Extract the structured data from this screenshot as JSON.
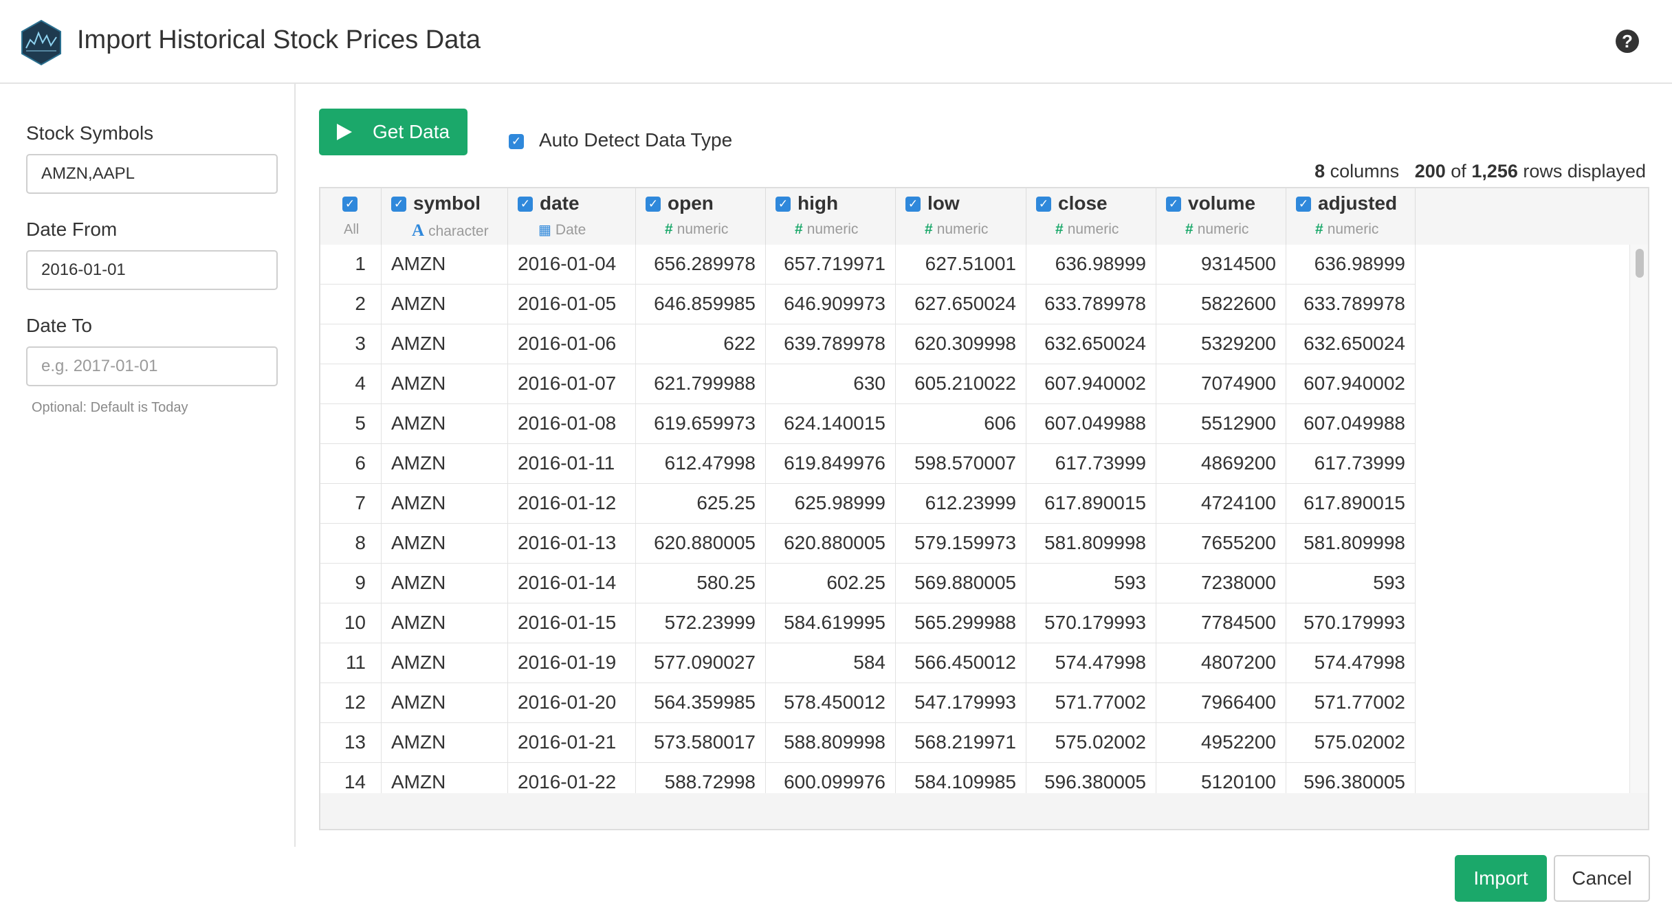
{
  "window": {
    "title": "Import Historical Stock Prices Data",
    "logo_icon": "tidyquant-hex-logo",
    "help_icon": "question-circle-icon"
  },
  "sidebar": {
    "symbols_label": "Stock Symbols",
    "symbols_value": "AMZN,AAPL",
    "date_from_label": "Date From",
    "date_from_value": "2016-01-01",
    "date_to_label": "Date To",
    "date_to_value": "",
    "date_to_placeholder": "e.g. 2017-01-01",
    "date_to_hint": "Optional: Default is Today"
  },
  "toolbar": {
    "get_data_label": "Get Data",
    "auto_detect_label": "Auto Detect Data Type",
    "auto_detect_checked": true
  },
  "summary": {
    "columns_count": "8",
    "columns_word": "columns",
    "rows_shown": "200",
    "of_word": "of",
    "rows_total": "1,256",
    "rows_word": "rows displayed"
  },
  "table": {
    "all_label": "All",
    "columns": [
      {
        "name": "symbol",
        "type": "character",
        "type_icon": "A"
      },
      {
        "name": "date",
        "type": "Date",
        "type_icon": "calendar-icon"
      },
      {
        "name": "open",
        "type": "numeric",
        "type_icon": "#"
      },
      {
        "name": "high",
        "type": "numeric",
        "type_icon": "#"
      },
      {
        "name": "low",
        "type": "numeric",
        "type_icon": "#"
      },
      {
        "name": "close",
        "type": "numeric",
        "type_icon": "#"
      },
      {
        "name": "volume",
        "type": "numeric",
        "type_icon": "#"
      },
      {
        "name": "adjusted",
        "type": "numeric",
        "type_icon": "#"
      }
    ],
    "rows": [
      [
        "1",
        "AMZN",
        "2016-01-04",
        "656.289978",
        "657.719971",
        "627.51001",
        "636.98999",
        "9314500",
        "636.98999"
      ],
      [
        "2",
        "AMZN",
        "2016-01-05",
        "646.859985",
        "646.909973",
        "627.650024",
        "633.789978",
        "5822600",
        "633.789978"
      ],
      [
        "3",
        "AMZN",
        "2016-01-06",
        "622",
        "639.789978",
        "620.309998",
        "632.650024",
        "5329200",
        "632.650024"
      ],
      [
        "4",
        "AMZN",
        "2016-01-07",
        "621.799988",
        "630",
        "605.210022",
        "607.940002",
        "7074900",
        "607.940002"
      ],
      [
        "5",
        "AMZN",
        "2016-01-08",
        "619.659973",
        "624.140015",
        "606",
        "607.049988",
        "5512900",
        "607.049988"
      ],
      [
        "6",
        "AMZN",
        "2016-01-11",
        "612.47998",
        "619.849976",
        "598.570007",
        "617.73999",
        "4869200",
        "617.73999"
      ],
      [
        "7",
        "AMZN",
        "2016-01-12",
        "625.25",
        "625.98999",
        "612.23999",
        "617.890015",
        "4724100",
        "617.890015"
      ],
      [
        "8",
        "AMZN",
        "2016-01-13",
        "620.880005",
        "620.880005",
        "579.159973",
        "581.809998",
        "7655200",
        "581.809998"
      ],
      [
        "9",
        "AMZN",
        "2016-01-14",
        "580.25",
        "602.25",
        "569.880005",
        "593",
        "7238000",
        "593"
      ],
      [
        "10",
        "AMZN",
        "2016-01-15",
        "572.23999",
        "584.619995",
        "565.299988",
        "570.179993",
        "7784500",
        "570.179993"
      ],
      [
        "11",
        "AMZN",
        "2016-01-19",
        "577.090027",
        "584",
        "566.450012",
        "574.47998",
        "4807200",
        "574.47998"
      ],
      [
        "12",
        "AMZN",
        "2016-01-20",
        "564.359985",
        "578.450012",
        "547.179993",
        "571.77002",
        "7966400",
        "571.77002"
      ],
      [
        "13",
        "AMZN",
        "2016-01-21",
        "573.580017",
        "588.809998",
        "568.219971",
        "575.02002",
        "4952200",
        "575.02002"
      ],
      [
        "14",
        "AMZN",
        "2016-01-22",
        "588.72998",
        "600.099976",
        "584.109985",
        "596.380005",
        "5120100",
        "596.380005"
      ]
    ]
  },
  "footer": {
    "import_label": "Import",
    "cancel_label": "Cancel"
  },
  "colors": {
    "primary_green": "#1ba86a",
    "checkbox_blue": "#2f88db"
  }
}
